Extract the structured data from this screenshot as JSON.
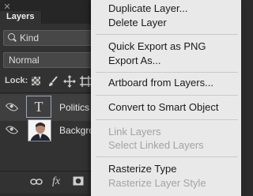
{
  "panel": {
    "tab_label": "Layers",
    "filter_kind": "Kind",
    "blend_mode": "Normal",
    "lock_label": "Lock:",
    "layers": [
      {
        "name": "Politics i",
        "type": "text",
        "thumb_glyph": "T",
        "visible": true,
        "selected": true
      },
      {
        "name": "Backgro",
        "type": "image",
        "visible": true,
        "selected": false
      }
    ],
    "bottom_icons": [
      "link-icon",
      "fx-icon",
      "mask-icon"
    ],
    "fx_label": "fx"
  },
  "menu": {
    "items": [
      {
        "label": "Duplicate Layer...",
        "enabled": true
      },
      {
        "label": "Delete Layer",
        "enabled": true
      },
      {
        "label": "Quick Export as PNG",
        "enabled": true
      },
      {
        "label": "Export As...",
        "enabled": true
      },
      {
        "label": "Artboard from Layers...",
        "enabled": true
      },
      {
        "label": "Convert to Smart Object",
        "enabled": true
      },
      {
        "label": "Link Layers",
        "enabled": false
      },
      {
        "label": "Select Linked Layers",
        "enabled": false
      },
      {
        "label": "Rasterize Type",
        "enabled": true
      },
      {
        "label": "Rasterize Layer Style",
        "enabled": false
      }
    ]
  }
}
